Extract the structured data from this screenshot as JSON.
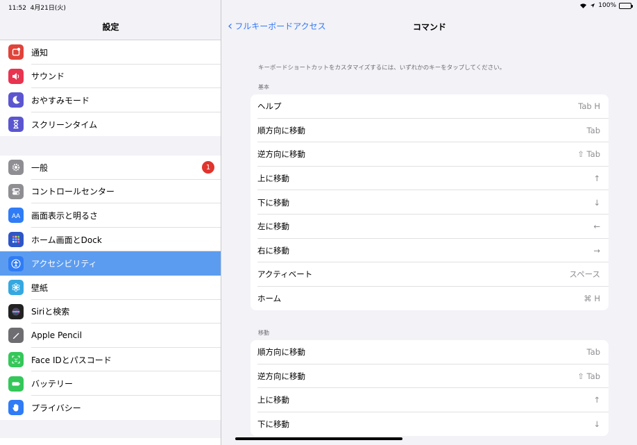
{
  "status_bar": {
    "time": "11:52",
    "date": "4月21日(火)",
    "battery": "100%",
    "accent_green": "#34c759"
  },
  "sidebar": {
    "title": "設定",
    "groups": [
      [
        {
          "label": "通知",
          "icon": "bell-badge-icon",
          "color": "#e0433a"
        },
        {
          "label": "サウンド",
          "icon": "speaker-icon",
          "color": "#e8344f"
        },
        {
          "label": "おやすみモード",
          "icon": "moon-icon",
          "color": "#5b56d0"
        },
        {
          "label": "スクリーンタイム",
          "icon": "hourglass-icon",
          "color": "#5b56d0"
        }
      ],
      [
        {
          "label": "一般",
          "icon": "gear-icon",
          "color": "#8e8e93",
          "badge": "1"
        },
        {
          "label": "コントロールセンター",
          "icon": "toggles-icon",
          "color": "#8e8e93"
        },
        {
          "label": "画面表示と明るさ",
          "icon": "text-size-icon",
          "color": "#2f7cf6"
        },
        {
          "label": "ホーム画面とDock",
          "icon": "app-grid-icon",
          "color": "#2f56c7"
        },
        {
          "label": "アクセシビリティ",
          "icon": "accessibility-icon",
          "color": "#2f7cf6",
          "selected": true
        },
        {
          "label": "壁紙",
          "icon": "flower-icon",
          "color": "#35a8e0"
        },
        {
          "label": "Siriと検索",
          "icon": "siri-icon",
          "color": "#222222"
        },
        {
          "label": "Apple Pencil",
          "icon": "pencil-icon",
          "color": "#6d6d72"
        },
        {
          "label": "Face IDとパスコード",
          "icon": "face-id-icon",
          "color": "#34c759"
        },
        {
          "label": "バッテリー",
          "icon": "battery-icon",
          "color": "#34c759"
        },
        {
          "label": "プライバシー",
          "icon": "hand-icon",
          "color": "#2f7cf6"
        }
      ]
    ],
    "selected_color": "#5c9cf0"
  },
  "main": {
    "back_label": "フルキーボードアクセス",
    "title": "コマンド",
    "instruction": "キーボードショートカットをカスタマイズするには、いずれかのキーをタップしてください。",
    "accent": "#3478f6",
    "sections": [
      {
        "header": "基本",
        "rows": [
          {
            "label": "ヘルプ",
            "key": "Tab H"
          },
          {
            "label": "順方向に移動",
            "key": "Tab"
          },
          {
            "label": "逆方向に移動",
            "key": "⇧ Tab"
          },
          {
            "label": "上に移動",
            "key": "↑"
          },
          {
            "label": "下に移動",
            "key": "↓"
          },
          {
            "label": "左に移動",
            "key": "←"
          },
          {
            "label": "右に移動",
            "key": "→"
          },
          {
            "label": "アクティベート",
            "key": "スペース"
          },
          {
            "label": "ホーム",
            "key": "⌘ H"
          }
        ]
      },
      {
        "header": "移動",
        "rows": [
          {
            "label": "順方向に移動",
            "key": "Tab"
          },
          {
            "label": "逆方向に移動",
            "key": "⇧ Tab"
          },
          {
            "label": "上に移動",
            "key": "↑"
          },
          {
            "label": "下に移動",
            "key": "↓"
          }
        ]
      }
    ]
  }
}
